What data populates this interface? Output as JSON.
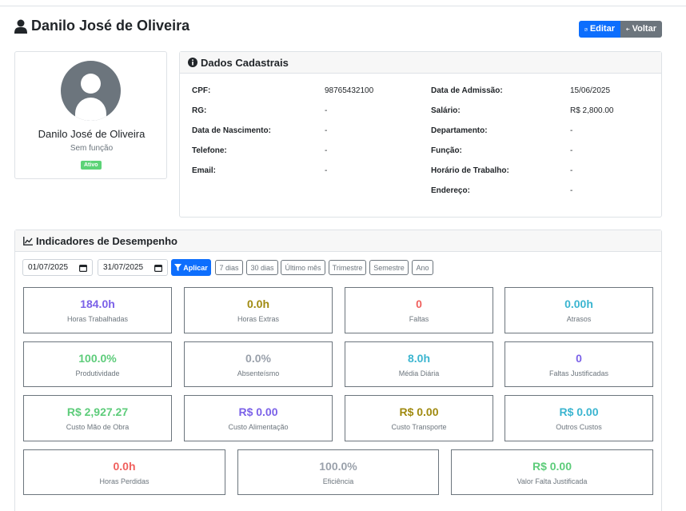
{
  "header": {
    "title": "Danilo José de Oliveira",
    "edit_label": "Editar",
    "back_label": "Voltar"
  },
  "profile": {
    "name": "Danilo José de Oliveira",
    "role": "Sem função",
    "status": "Ativo"
  },
  "dados": {
    "title": "Dados Cadastrais",
    "left": [
      {
        "label": "CPF:",
        "value": "98765432100"
      },
      {
        "label": "RG:",
        "value": "-"
      },
      {
        "label": "Data de Nascimento:",
        "value": "-"
      },
      {
        "label": "Telefone:",
        "value": "-"
      },
      {
        "label": "Email:",
        "value": "-"
      }
    ],
    "right": [
      {
        "label": "Data de Admissão:",
        "value": "15/06/2025"
      },
      {
        "label": "Salário:",
        "value": "R$ 2,800.00"
      },
      {
        "label": "Departamento:",
        "value": "-"
      },
      {
        "label": "Função:",
        "value": "-"
      },
      {
        "label": "Horário de Trabalho:",
        "value": "-"
      },
      {
        "label": "Endereço:",
        "value": "-"
      }
    ]
  },
  "indicadores": {
    "title": "Indicadores de Desempenho",
    "date_start": "01/07/2025",
    "date_end": "31/07/2025",
    "apply_label": "Aplicar",
    "periods": [
      "7 dias",
      "30 dias",
      "Último mês",
      "Trimestre",
      "Semestre",
      "Ano"
    ],
    "metrics": [
      {
        "value": "184.0h",
        "label": "Horas Trabalhadas",
        "color": "#7b61e8"
      },
      {
        "value": "0.0h",
        "label": "Horas Extras",
        "color": "#a08a10"
      },
      {
        "value": "0",
        "label": "Faltas",
        "color": "#f0605d"
      },
      {
        "value": "0.00h",
        "label": "Atrasos",
        "color": "#3bb5d0"
      },
      {
        "value": "100.0%",
        "label": "Produtividade",
        "color": "#5dcc7a"
      },
      {
        "value": "0.0%",
        "label": "Absenteísmo",
        "color": "#9aa1ab"
      },
      {
        "value": "8.0h",
        "label": "Média Diária",
        "color": "#3bb5d0"
      },
      {
        "value": "0",
        "label": "Faltas Justificadas",
        "color": "#7b61e8"
      },
      {
        "value": "R$ 2,927.27",
        "label": "Custo Mão de Obra",
        "color": "#5dcc7a"
      },
      {
        "value": "R$ 0.00",
        "label": "Custo Alimentação",
        "color": "#7b61e8"
      },
      {
        "value": "R$ 0.00",
        "label": "Custo Transporte",
        "color": "#a08a10"
      },
      {
        "value": "R$ 0.00",
        "label": "Outros Custos",
        "color": "#3bb5d0"
      },
      {
        "value": "0.0h",
        "label": "Horas Perdidas",
        "color": "#f0605d"
      },
      {
        "value": "100.0%",
        "label": "Eficiência",
        "color": "#9aa1ab"
      },
      {
        "value": "R$ 0.00",
        "label": "Valor Falta Justificada",
        "color": "#5dcc7a"
      }
    ]
  }
}
